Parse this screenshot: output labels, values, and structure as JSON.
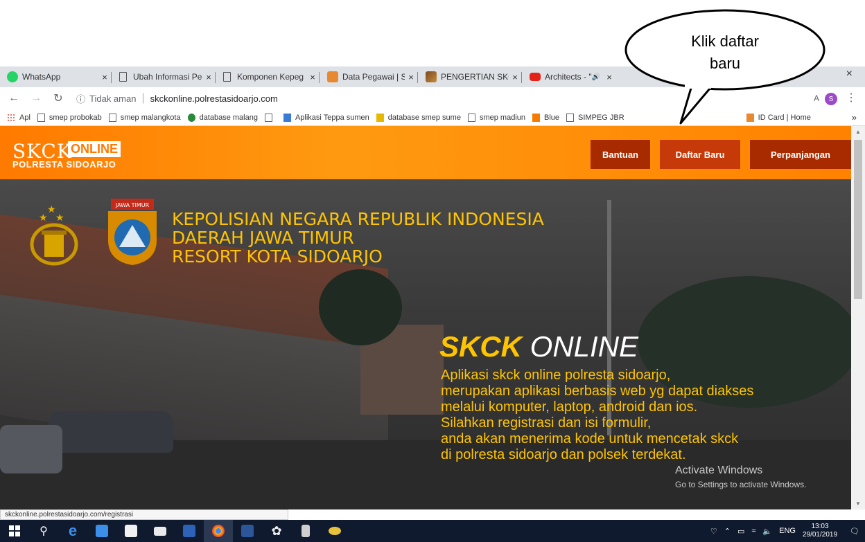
{
  "callout": {
    "line1": "Klik daftar",
    "line2": "baru"
  },
  "tabs": [
    {
      "title": "WhatsApp",
      "icon": "whatsapp-icon"
    },
    {
      "title": "Ubah Informasi Pe",
      "icon": "document-icon"
    },
    {
      "title": "Komponen Kepeg",
      "icon": "document-icon"
    },
    {
      "title": "Data Pegawai | SK",
      "icon": "orange-favicon"
    },
    {
      "title": "PENGERTIAN SKCI",
      "icon": "image-favicon"
    },
    {
      "title": "Architects - \"H",
      "icon": "youtube-icon"
    }
  ],
  "tab_close": "×",
  "window_close": "×",
  "addressbar": {
    "security_text": "Tidak aman",
    "url": "skckonline.polrestasidoarjo.com",
    "profile_initial": "S",
    "partial_right": "A"
  },
  "bookmarks": [
    {
      "label": "Apl",
      "icon": "apps-icon"
    },
    {
      "label": "smep probokab",
      "icon": "document-icon"
    },
    {
      "label": "smep malangkota",
      "icon": "document-icon"
    },
    {
      "label": "database malang",
      "icon": "green-favicon"
    },
    {
      "label": "",
      "icon": "document-icon"
    },
    {
      "label": "Aplikasi Teppa sumen",
      "icon": "bucket-icon"
    },
    {
      "label": "database smep sume",
      "icon": "pma-icon"
    },
    {
      "label": "smep madiun",
      "icon": "document-icon"
    },
    {
      "label": "Blue",
      "icon": "blogger-icon"
    },
    {
      "label": "SIMPEG JBR",
      "icon": "document-icon"
    },
    {
      "label": "ID Card | Home",
      "icon": "orange-favicon"
    }
  ],
  "bookmarks_more": "»",
  "site": {
    "logo_skck": "SKCK",
    "logo_online": "ONLINE",
    "logo_sub": "POLRESTA SIDOARJO",
    "nav": {
      "bantuan": "Bantuan",
      "daftar": "Daftar Baru",
      "perpanjangan": "Perpanjangan"
    },
    "emblem_banner": "JAWA TIMUR",
    "hero_title": [
      "KEPOLISIAN NEGARA REPUBLIK INDONESIA",
      "DAERAH JAWA TIMUR",
      "RESORT KOTA SIDOARJO"
    ],
    "brand_bold": "SKCK",
    "brand_light": " ONLINE",
    "description": [
      "Aplikasi skck online polresta sidoarjo,",
      "merupakan aplikasi berbasis web yg dapat diakses",
      "melalui komputer, laptop, android dan ios.",
      "Silahkan registrasi dan isi formulir,",
      "anda akan menerima kode untuk mencetak skck",
      "di polresta sidoarjo dan polsek terdekat."
    ]
  },
  "watermark": {
    "line1": "Activate Windows",
    "line2": "Go to Settings to activate Windows."
  },
  "status_url": "skckonline.polrestasidoarjo.com/registrasi",
  "taskbar": {
    "lang": "ENG",
    "time": "13:03",
    "date": "29/01/2019"
  },
  "colors": {
    "orange": "#ff8a00",
    "nav_dark": "#a82b00",
    "hero_yellow": "#ffc400",
    "taskbar": "#101a2e"
  }
}
